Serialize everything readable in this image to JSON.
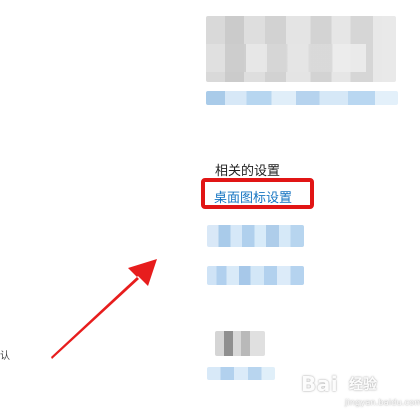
{
  "settings_panel": {
    "section_title": "相关的设置",
    "highlighted_link": "桌面图标设置",
    "left_fragment_text": "认"
  },
  "overlay": {
    "arrow_color": "#e71d1d",
    "highlight_color": "#e11515"
  },
  "watermark": {
    "brand": "Bai",
    "sub": "经验",
    "url": "jingyan.baidu.com"
  }
}
